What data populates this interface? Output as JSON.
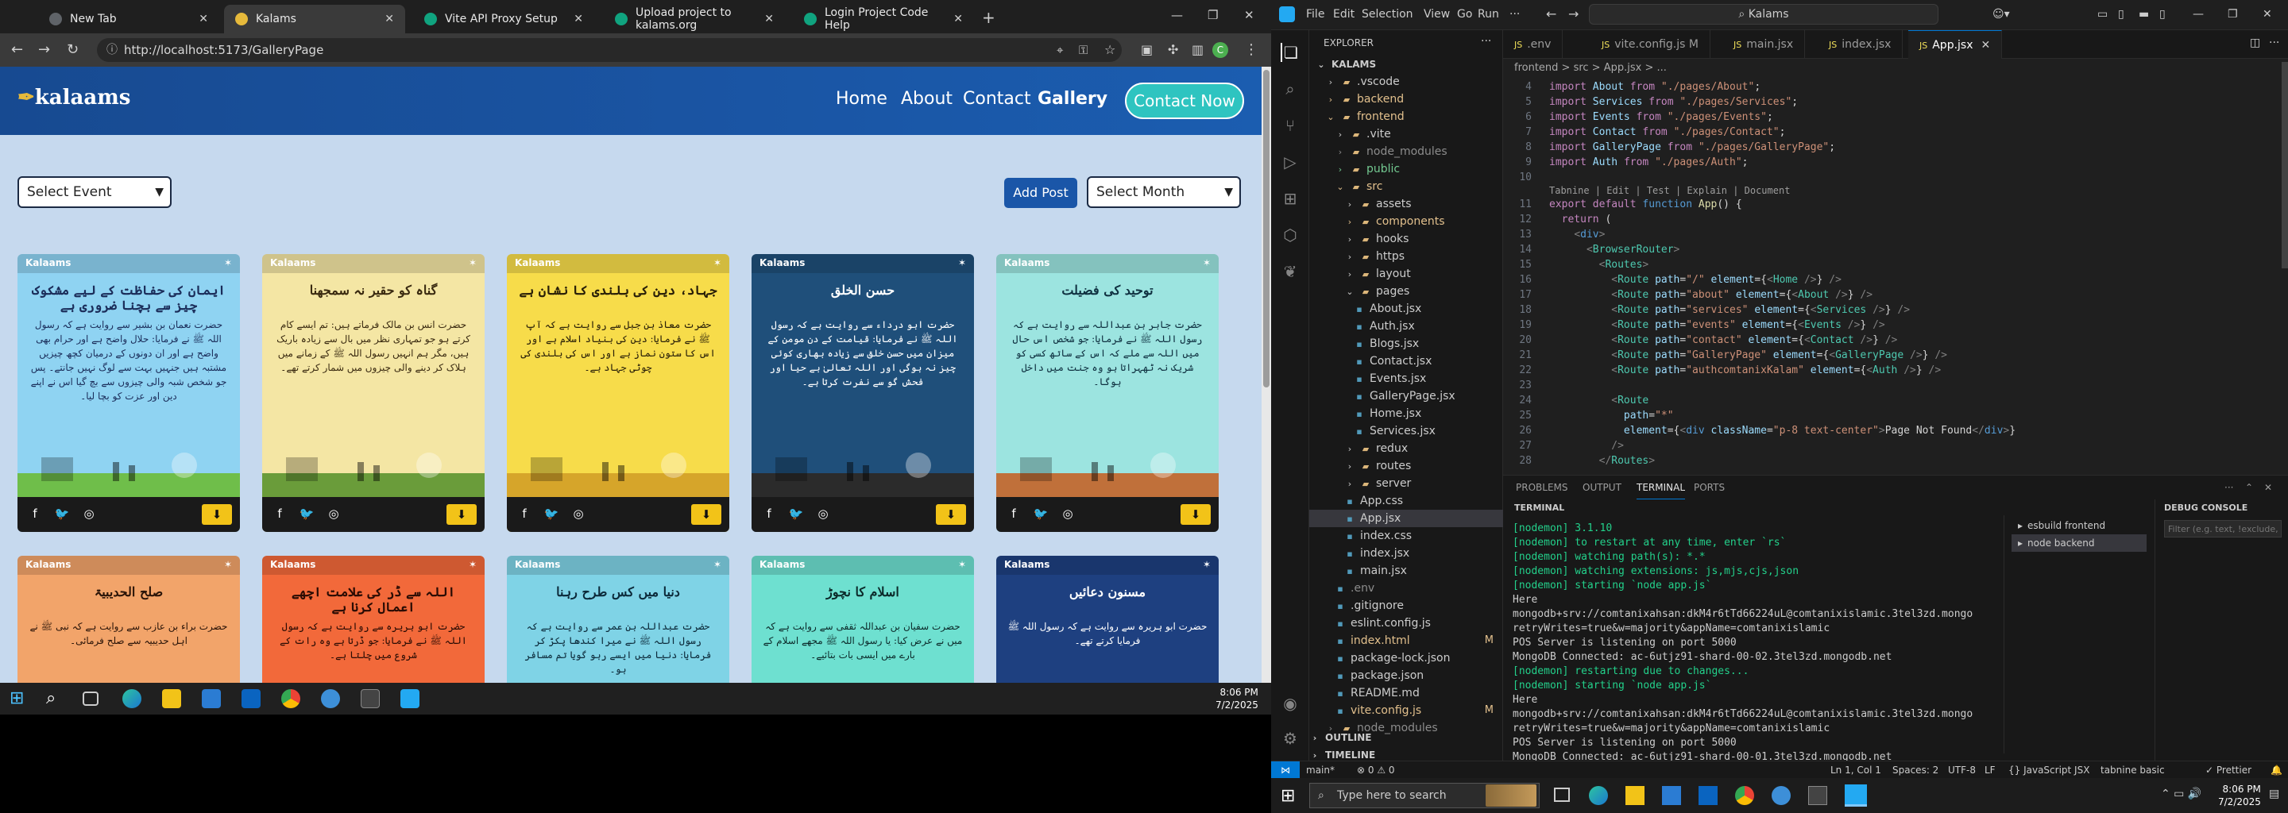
{
  "browser": {
    "tabs": [
      {
        "label": "New Tab",
        "active": false,
        "color": "#5f6368"
      },
      {
        "label": "Kalams",
        "active": true,
        "color": "#e6b93b"
      },
      {
        "label": "Vite API Proxy Setup",
        "active": false,
        "color": "#10a37f"
      },
      {
        "label": "Upload project to kalams.org",
        "active": false,
        "color": "#10a37f"
      },
      {
        "label": "Login Project Code Help",
        "active": false,
        "color": "#10a37f"
      }
    ],
    "url": "http://localhost:5173/GalleryPage"
  },
  "site": {
    "logo": "kalaams",
    "menu": [
      "Home",
      "About",
      "Contact",
      "Gallery"
    ],
    "contact_button": "Contact Now",
    "select_event": "Select Event",
    "add_post": "Add Post",
    "select_month": "Select Month",
    "card_brand": "Kalaams",
    "cards": [
      {
        "title": "ایمان کی حفاظت کے لیے مشکوک چیز سے بچنا ضروری ہے",
        "text": "حضرت نعمان بن بشیر سے روایت ہے کہ رسول اللہ ﷺ نے فرمایا: حلال واضح ہے اور حرام بھی واضح ہے اور ان دونوں کے درمیان کچھ چیزیں مشتبہ ہیں جنہیں بہت سے لوگ نہیں جانتے۔ پس جو شخص شبہ والی چیزوں سے بچ گیا اس نے اپنے دین اور عزت کو بچا لیا۔",
        "bg": "#8fd3f2",
        "ink": "#1b2d5a",
        "scene": "#6fbe4a"
      },
      {
        "title": "گناہ کو حقیر نہ سمجھنا",
        "text": "حضرت انس بن مالک فرماتے ہیں: تم ایسے کام کرتے ہو جو تمہاری نظر میں بال سے زیادہ باریک ہیں، مگر ہم انہیں رسول اللہ ﷺ کے زمانے میں ہلاک کر دینے والی چیزوں میں شمار کرتے تھے۔",
        "bg": "#f4e6a4",
        "ink": "#3a2a10",
        "scene": "#6a9c3a"
      },
      {
        "title": "جہاد، دین کی بلندی کا نشان ہے",
        "text": "حضرت معاذ بن جبل سے روایت ہے کہ آپ ﷺ نے فرمایا: دین کی بنیاد اسلام ہے اور اس کا ستون نماز ہے اور اس کی بلندی کی چوٹی جہاد ہے۔",
        "bg": "#f7dc4a",
        "ink": "#2a2008",
        "scene": "#d6a52a"
      },
      {
        "title": "حسن الخلق",
        "text": "حضرت ابو درداء سے روایت ہے کہ رسول اللہ ﷺ نے فرمایا: قیامت کے دن مومن کے میزان میں حسن خلق سے زیادہ بھاری کوئی چیز نہ ہوگی اور اللہ تعالیٰ بے حیا اور فحش گو سے نفرت کرتا ہے۔",
        "bg": "#1f4f7a",
        "ink": "#ffffff",
        "scene": "#2b2b2b"
      },
      {
        "title": "توحید کی فضیلت",
        "text": "حضرت جابر بن عبداللہ سے روایت ہے کہ رسول اللہ ﷺ نے فرمایا: جو شخص اس حال میں اللہ سے ملے کہ اس کے ساتھ کسی کو شریک نہ ٹھہراتا ہو وہ جنت میں داخل ہوگا۔",
        "bg": "#9ce4e0",
        "ink": "#0f3040",
        "scene": "#c0703a"
      },
      {
        "title": "صلح الحدیبیۃ",
        "text": "حضرت براء بن عازب سے روایت ہے کہ نبی ﷺ نے اہل حدیبیہ سے صلح فرمائی۔",
        "bg": "#f2a46a",
        "ink": "#2a1408",
        "scene": "#c0703a"
      },
      {
        "title": "اللہ سے ڈر کی علامت اچھے اعمال کرنا ہے",
        "text": "حضرت ابو ہریرہ سے روایت ہے کہ رسول اللہ ﷺ نے فرمایا: جو ڈرتا ہے وہ رات کے شروع میں چلتا ہے۔",
        "bg": "#f2693a",
        "ink": "#2a0c04",
        "scene": "#8a3a1a"
      },
      {
        "title": "دنیا میں کس طرح رہنا",
        "text": "حضرت عبداللہ بن عمر سے روایت ہے کہ رسول اللہ ﷺ نے میرا کندھا پکڑ کر فرمایا: دنیا میں ایسے رہو گویا تم مسافر ہو۔",
        "bg": "#7fd3e6",
        "ink": "#0c2a3a",
        "scene": "#4a8aa8"
      },
      {
        "title": "اسلام کا نچوڑ",
        "text": "حضرت سفیان بن عبداللہ ثقفی سے روایت ہے کہ میں نے عرض کیا: یا رسول اللہ ﷺ مجھے اسلام کے بارے میں ایسی بات بتائیے۔",
        "bg": "#6ee0d0",
        "ink": "#0c2a2a",
        "scene": "#3aa890"
      },
      {
        "title": "مسنون دعائیں",
        "text": "حضرت ابو ہریرہ سے روایت ہے کہ رسول اللہ ﷺ فرمایا کرتے تھے۔",
        "bg": "#1e4080",
        "ink": "#ffffff",
        "scene": "#2a2a5a"
      }
    ],
    "icons": [
      "facebook-icon",
      "twitter-icon",
      "instagram-icon",
      "download-icon"
    ]
  },
  "taskbar1": {
    "time": "8:06 PM",
    "date": "7/2/2025"
  },
  "vscode": {
    "menu": [
      "File",
      "Edit",
      "Selection",
      "View",
      "Go",
      "Run"
    ],
    "search": "Kalams",
    "explorer_title": "EXPLORER",
    "tree": [
      {
        "label": "KALAMS",
        "depth": 0,
        "kind": "root"
      },
      {
        "label": ".vscode",
        "depth": 1,
        "kind": "folder"
      },
      {
        "label": "backend",
        "depth": 1,
        "kind": "folder",
        "color": "#e2c08d"
      },
      {
        "label": "frontend",
        "depth": 1,
        "kind": "folder-open",
        "color": "#e2c08d"
      },
      {
        "label": ".vite",
        "depth": 2,
        "kind": "folder"
      },
      {
        "label": "node_modules",
        "depth": 2,
        "kind": "folder",
        "color": "#8c8c8c"
      },
      {
        "label": "public",
        "depth": 2,
        "kind": "folder",
        "color": "#73c991"
      },
      {
        "label": "src",
        "depth": 2,
        "kind": "folder-open",
        "color": "#e2c08d"
      },
      {
        "label": "assets",
        "depth": 3,
        "kind": "folder"
      },
      {
        "label": "components",
        "depth": 3,
        "kind": "folder",
        "color": "#e2c08d"
      },
      {
        "label": "hooks",
        "depth": 3,
        "kind": "folder"
      },
      {
        "label": "https",
        "depth": 3,
        "kind": "folder"
      },
      {
        "label": "layout",
        "depth": 3,
        "kind": "folder"
      },
      {
        "label": "pages",
        "depth": 3,
        "kind": "folder-open"
      },
      {
        "label": "About.jsx",
        "depth": 4,
        "kind": "file"
      },
      {
        "label": "Auth.jsx",
        "depth": 4,
        "kind": "file"
      },
      {
        "label": "Blogs.jsx",
        "depth": 4,
        "kind": "file"
      },
      {
        "label": "Contact.jsx",
        "depth": 4,
        "kind": "file"
      },
      {
        "label": "Events.jsx",
        "depth": 4,
        "kind": "file"
      },
      {
        "label": "GalleryPage.jsx",
        "depth": 4,
        "kind": "file"
      },
      {
        "label": "Home.jsx",
        "depth": 4,
        "kind": "file"
      },
      {
        "label": "Services.jsx",
        "depth": 4,
        "kind": "file"
      },
      {
        "label": "redux",
        "depth": 3,
        "kind": "folder"
      },
      {
        "label": "routes",
        "depth": 3,
        "kind": "folder"
      },
      {
        "label": "server",
        "depth": 3,
        "kind": "folder"
      },
      {
        "label": "App.css",
        "depth": 3,
        "kind": "file"
      },
      {
        "label": "App.jsx",
        "depth": 3,
        "kind": "file",
        "selected": true
      },
      {
        "label": "index.css",
        "depth": 3,
        "kind": "file"
      },
      {
        "label": "index.jsx",
        "depth": 3,
        "kind": "file"
      },
      {
        "label": "main.jsx",
        "depth": 3,
        "kind": "file"
      },
      {
        "label": ".env",
        "depth": 2,
        "kind": "file",
        "color": "#8c8c8c"
      },
      {
        "label": ".gitignore",
        "depth": 2,
        "kind": "file"
      },
      {
        "label": "eslint.config.js",
        "depth": 2,
        "kind": "file"
      },
      {
        "label": "index.html",
        "depth": 2,
        "kind": "file",
        "color": "#e2c08d",
        "badge": "M"
      },
      {
        "label": "package-lock.json",
        "depth": 2,
        "kind": "file"
      },
      {
        "label": "package.json",
        "depth": 2,
        "kind": "file"
      },
      {
        "label": "README.md",
        "depth": 2,
        "kind": "file"
      },
      {
        "label": "vite.config.js",
        "depth": 2,
        "kind": "file",
        "color": "#e2c08d",
        "badge": "M"
      },
      {
        "label": "node_modules",
        "depth": 1,
        "kind": "folder",
        "color": "#8c8c8c"
      }
    ],
    "outline": "OUTLINE",
    "timeline": "TIMELINE",
    "editor_tabs": [
      {
        "label": ".env",
        "active": false
      },
      {
        "label": "vite.config.js M",
        "active": false
      },
      {
        "label": "main.jsx",
        "active": false
      },
      {
        "label": "index.jsx",
        "active": false
      },
      {
        "label": "App.jsx",
        "active": true
      }
    ],
    "breadcrumb": "frontend > src > App.jsx > ...",
    "panel_tabs": [
      "PROBLEMS",
      "OUTPUT",
      "TERMINAL",
      "PORTS"
    ],
    "terminal_title": "TERMINAL",
    "terminal_lines": [
      {
        "t": "[nodemon] 3.1.10",
        "g": true
      },
      {
        "t": "[nodemon] to restart at any time, enter `rs`",
        "g": true
      },
      {
        "t": "[nodemon] watching path(s): *.*",
        "g": true
      },
      {
        "t": "[nodemon] watching extensions: js,mjs,cjs,json",
        "g": true
      },
      {
        "t": "[nodemon] starting `node app.js`",
        "g": true
      },
      {
        "t": "Here",
        "g": false
      },
      {
        "t": "mongodb+srv://comtanixahsan:dkM4r6tTd66224uL@comtanixislamic.3tel3zd.mongodb.net/?",
        "g": false
      },
      {
        "t": "retryWrites=true&w=majority&appName=comtanixislamic",
        "g": false
      },
      {
        "t": "POS Server is listening on port 5000",
        "g": false
      },
      {
        "t": "MongoDB Connected: ac-6utjz91-shard-00-02.3tel3zd.mongodb.net",
        "g": false
      },
      {
        "t": "[nodemon] restarting due to changes...",
        "g": true
      },
      {
        "t": "[nodemon] starting `node app.js`",
        "g": true
      },
      {
        "t": "Here",
        "g": false
      },
      {
        "t": "mongodb+srv://comtanixahsan:dkM4r6tTd66224uL@comtanixislamic.3tel3zd.mongodb.net/?",
        "g": false
      },
      {
        "t": "retryWrites=true&w=majority&appName=comtanixislamic",
        "g": false
      },
      {
        "t": "POS Server is listening on port 5000",
        "g": false
      },
      {
        "t": "MongoDB Connected: ac-6utjz91-shard-00-01.3tel3zd.mongodb.net",
        "g": false
      }
    ],
    "terminals": [
      "esbuild frontend",
      "node backend"
    ],
    "debug_console": "DEBUG CONSOLE",
    "debug_filter_placeholder": "Filter (e.g. text, !exclude, \\escape)",
    "status": {
      "branch": "main*",
      "problems": "⊗ 0 ⚠ 0",
      "cursor": "Ln 1, Col 1",
      "spaces": "Spaces: 2",
      "encoding": "UTF-8",
      "eol": "LF",
      "lang": "{} JavaScript JSX",
      "tabnine": "tabnine basic",
      "prettier": "✓ Prettier"
    }
  },
  "taskbar2": {
    "search": "Type here to search",
    "time": "8:06 PM",
    "date": "7/2/2025"
  }
}
